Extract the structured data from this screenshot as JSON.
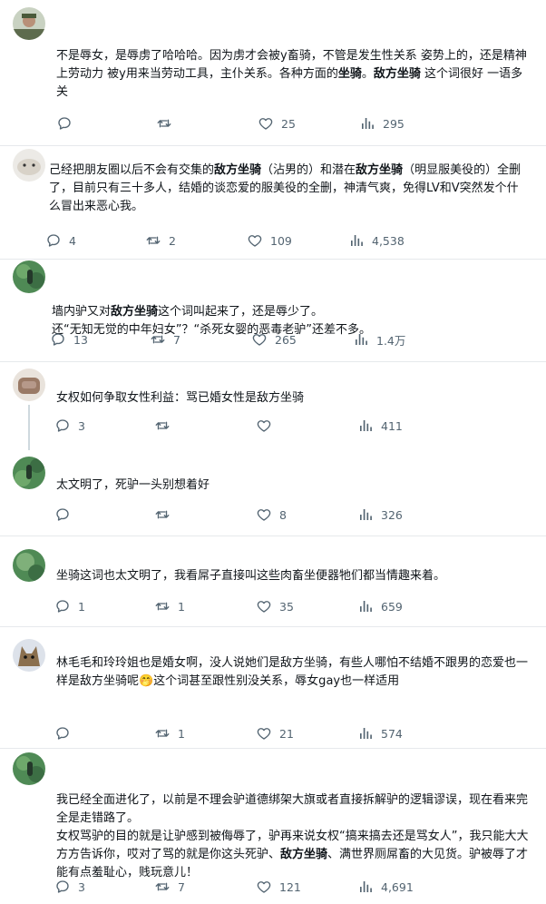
{
  "posts": [
    {
      "text_parts": [
        "不是辱女，是辱虏了哈哈哈。因为虏才会被y畜骑，不管是发生性关系 姿势上的，还是精神上劳动力 被y用来当劳动工具，主仆关系。各种方面的",
        "坐骑",
        "。",
        "敌方坐骑",
        " 这个词很好 一语多关"
      ],
      "replies": "",
      "reposts": "",
      "likes": "25",
      "views": "295"
    },
    {
      "text_parts": [
        "己经把朋友圈以后不会有交集的",
        "敌方坐骑",
        "（沾男的）和潜在",
        "敌方坐骑",
        "（明显服美役的）全删了，目前只有三十多人，结婚的谈恋爱的服美役的全删，神清气爽，免得LV和V突然发个什么冒出来恶心我。"
      ],
      "replies": "4",
      "reposts": "2",
      "likes": "109",
      "views": "4,538"
    },
    {
      "text_parts": [
        "墙内驴又对",
        "敌方坐骑",
        "这个词叫起来了，还是辱少了。\n还“无知无觉的中年妇女”？“杀死女婴的恶毒老驴”还差不多。"
      ],
      "replies": "13",
      "reposts": "7",
      "likes": "265",
      "views": "1.4万"
    },
    {
      "text_parts": [
        "女权如何争取女性利益：骂已婚女性是敌方坐骑"
      ],
      "replies": "3",
      "reposts": "",
      "likes": "",
      "views": "411"
    },
    {
      "text_parts": [
        "太文明了，死驴一头别想着好"
      ],
      "replies": "",
      "reposts": "",
      "likes": "8",
      "views": "326"
    },
    {
      "text_parts": [
        "坐骑这词也太文明了，我看屌子直接叫这些肉畜坐便器牠们都当情趣来着。"
      ],
      "replies": "1",
      "reposts": "1",
      "likes": "35",
      "views": "659"
    },
    {
      "text_parts": [
        "林毛毛和玲玲姐也是婚女啊，没人说她们是敌方坐骑，有些人哪怕不结婚不跟男的恋爱也一样是敌方坐骑呢🤭这个词甚至跟性别没关系，辱女gay也一样适用"
      ],
      "replies": "",
      "reposts": "1",
      "likes": "21",
      "views": "574"
    },
    {
      "text_parts": [
        "我已经全面进化了，以前是不理会驴道德绑架大旗或者直接拆解驴的逻辑谬误，现在看来完全是走错路了。\n女权骂驴的目的就是让驴感到被侮辱了，驴再来说女权“搞来搞去还是骂女人”，我只能大大方方告诉你，哎对了骂的就是你这头死驴、",
        "敌方坐骑",
        "、满世界厕屌畜的大见货。驴被辱了才能有点羞耻心，贱玩意儿！"
      ],
      "replies": "3",
      "reposts": "7",
      "likes": "121",
      "views": "4,691"
    }
  ],
  "icons": {
    "reply": "reply-icon",
    "repost": "repost-icon",
    "like": "like-icon",
    "views": "views-icon"
  },
  "colors": {
    "action_gray": "#536471",
    "text": "#0f1419",
    "divider": "#e6e9ec"
  }
}
